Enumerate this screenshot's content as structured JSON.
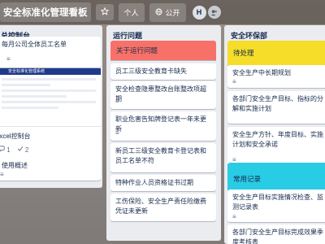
{
  "colors": {
    "accent_red": "#f87168",
    "accent_yellow": "#f5dd29",
    "accent_cyan": "#29cce5",
    "list_bg": "#ebecf0",
    "card_bg": "#ffffff"
  },
  "topbar": {
    "board_title": "安全标准化管理看板",
    "star_icon": "star-icon",
    "personal_label": "个人",
    "public_label": "公开",
    "globe_icon": "globe-icon",
    "avatar_initial": "H"
  },
  "lists": [
    {
      "title": "总控制台",
      "cards": [
        {
          "text": "每月公司全体员工名单"
        },
        {
          "badges": {
            "comments": "1",
            "checklist": "2"
          }
        },
        {
          "attachment_title": "安全标准化管理系统"
        },
        {
          "text": "Excel控制台"
        },
        {
          "text": "使用概述"
        }
      ]
    },
    {
      "title": "运行问题",
      "cards": [
        {
          "text": "关于运行问题",
          "cover": "red"
        },
        {
          "text": "员工三级安全教育卡缺失"
        },
        {
          "text": "安全检查隐患整改台账整改项超期"
        },
        {
          "text": "职业危害告知牌登记表一年未更新"
        },
        {
          "text": "新员工三级安全教育卡登记表和员工名单不符"
        },
        {
          "text": "特种作业人员资格证书过期"
        },
        {
          "text": "工伤保险、安全生产责任险缴费凭证未更新"
        }
      ]
    },
    {
      "title": "安全环保部",
      "cards": [
        {
          "text": "待处理",
          "cover": "yellow"
        },
        {
          "text": "安全生产中长期规划"
        },
        {
          "text": "各部门安全生产目标、指标的分解和实施计划"
        },
        {
          "text": "安全生产方针、年度目标、实施计划和安全承诺"
        },
        {
          "text": "常用记录",
          "cover": "cyan"
        },
        {
          "text": "安全生产目标实施情况检查、监测记录表"
        },
        {
          "text": "各部门安全生产目标完成效果季度考核表"
        }
      ]
    }
  ]
}
